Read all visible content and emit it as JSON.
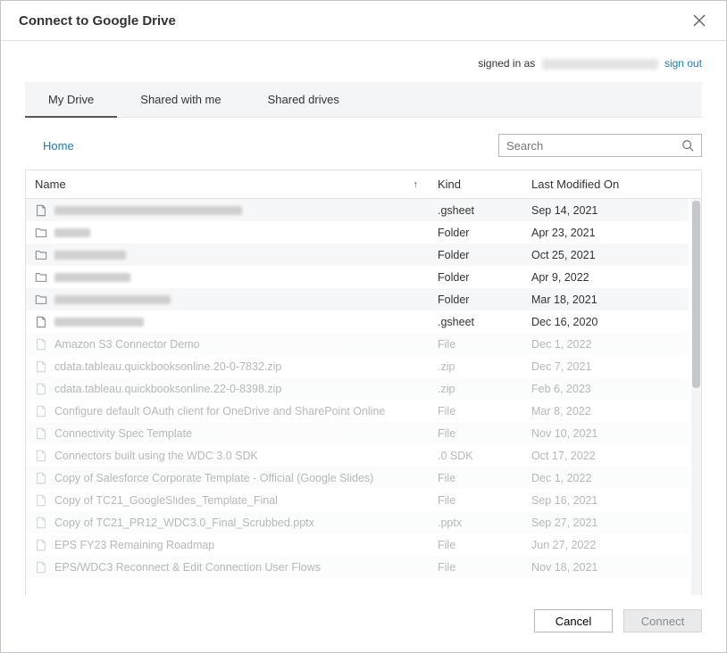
{
  "dialog": {
    "title": "Connect to Google Drive"
  },
  "auth": {
    "signed_in_as_label": "signed in as",
    "sign_out_label": "sign out"
  },
  "tabs": [
    {
      "label": "My Drive",
      "active": true
    },
    {
      "label": "Shared with me",
      "active": false
    },
    {
      "label": "Shared drives",
      "active": false
    }
  ],
  "breadcrumb": {
    "home_label": "Home"
  },
  "search": {
    "placeholder": "Search"
  },
  "columns": {
    "name": "Name",
    "kind": "Kind",
    "modified": "Last Modified On",
    "sort_indicator": "↑"
  },
  "rows": [
    {
      "icon": "file",
      "name": "",
      "name_redacted": true,
      "redact_width": 210,
      "kind": ".gsheet",
      "modified": "Sep 14, 2021",
      "faded": false
    },
    {
      "icon": "folder",
      "name": "",
      "name_redacted": true,
      "redact_width": 40,
      "kind": "Folder",
      "modified": "Apr 23, 2021",
      "faded": false
    },
    {
      "icon": "folder",
      "name": "",
      "name_redacted": true,
      "redact_width": 80,
      "kind": "Folder",
      "modified": "Oct 25, 2021",
      "faded": false
    },
    {
      "icon": "folder",
      "name": "",
      "name_redacted": true,
      "redact_width": 85,
      "kind": "Folder",
      "modified": "Apr 9, 2022",
      "faded": false
    },
    {
      "icon": "folder",
      "name": "",
      "name_redacted": true,
      "redact_width": 130,
      "kind": "Folder",
      "modified": "Mar 18, 2021",
      "faded": false
    },
    {
      "icon": "file",
      "name": "",
      "name_redacted": true,
      "redact_width": 100,
      "kind": ".gsheet",
      "modified": "Dec 16, 2020",
      "faded": false
    },
    {
      "icon": "file",
      "name": "Amazon S3 Connector Demo",
      "name_redacted": false,
      "kind": "File",
      "modified": "Dec 1, 2022",
      "faded": true
    },
    {
      "icon": "file",
      "name": "cdata.tableau.quickbooksonline.20-0-7832.zip",
      "name_redacted": false,
      "kind": ".zip",
      "modified": "Dec 7, 2021",
      "faded": true
    },
    {
      "icon": "file",
      "name": "cdata.tableau.quickbooksonline.22-0-8398.zip",
      "name_redacted": false,
      "kind": ".zip",
      "modified": "Feb 6, 2023",
      "faded": true
    },
    {
      "icon": "file",
      "name": "Configure default OAuth client for OneDrive and SharePoint Online",
      "name_redacted": false,
      "kind": "File",
      "modified": "Mar 8, 2022",
      "faded": true
    },
    {
      "icon": "file",
      "name": "Connectivity Spec Template",
      "name_redacted": false,
      "kind": "File",
      "modified": "Nov 10, 2021",
      "faded": true
    },
    {
      "icon": "file",
      "name": "Connectors built using the WDC 3.0 SDK",
      "name_redacted": false,
      "kind": ".0 SDK",
      "modified": "Oct 17, 2022",
      "faded": true
    },
    {
      "icon": "file",
      "name": "Copy of Salesforce Corporate Template - Official (Google Slides)",
      "name_redacted": false,
      "kind": "File",
      "modified": "Dec 1, 2022",
      "faded": true
    },
    {
      "icon": "file",
      "name": "Copy of TC21_GoogleSlides_Template_Final",
      "name_redacted": false,
      "kind": "File",
      "modified": "Sep 16, 2021",
      "faded": true
    },
    {
      "icon": "file",
      "name": "Copy of TC21_PR12_WDC3.0_Final_Scrubbed.pptx",
      "name_redacted": false,
      "kind": ".pptx",
      "modified": "Sep 27, 2021",
      "faded": true
    },
    {
      "icon": "file",
      "name": "EPS FY23 Remaining Roadmap",
      "name_redacted": false,
      "kind": "File",
      "modified": "Jun 27, 2022",
      "faded": true
    },
    {
      "icon": "file",
      "name": "EPS/WDC3 Reconnect & Edit Connection User Flows",
      "name_redacted": false,
      "kind": "File",
      "modified": "Nov 18, 2021",
      "faded": true
    }
  ],
  "footer": {
    "cancel_label": "Cancel",
    "connect_label": "Connect"
  }
}
